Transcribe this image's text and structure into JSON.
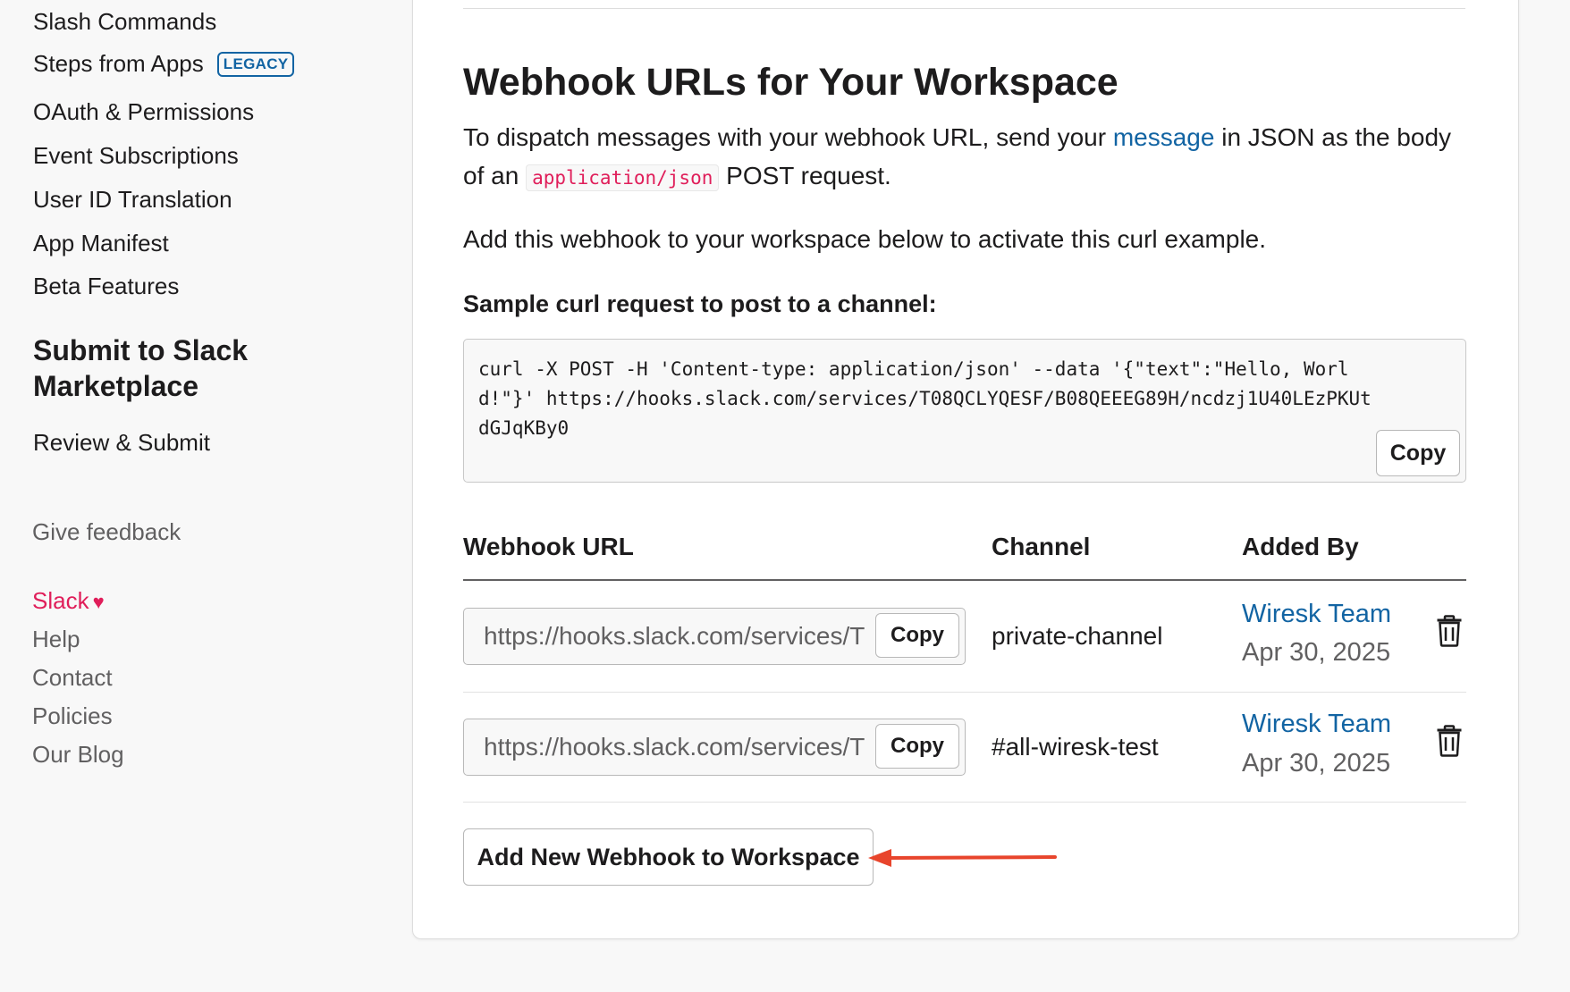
{
  "sidebar": {
    "items": [
      {
        "label": "Slash Commands"
      },
      {
        "label": "Steps from Apps",
        "badge": "LEGACY"
      },
      {
        "label": "OAuth & Permissions"
      },
      {
        "label": "Event Subscriptions"
      },
      {
        "label": "User ID Translation"
      },
      {
        "label": "App Manifest"
      },
      {
        "label": "Beta Features"
      }
    ],
    "section_heading": "Submit to Slack Marketplace",
    "section_items": [
      {
        "label": "Review & Submit"
      }
    ],
    "give_feedback": "Give feedback",
    "footer": {
      "slack": "Slack",
      "heart": "♥",
      "links": [
        "Help",
        "Contact",
        "Policies",
        "Our Blog"
      ]
    }
  },
  "main": {
    "title": "Webhook URLs for Your Workspace",
    "intro": {
      "part1": "To dispatch messages with your webhook URL, send your ",
      "link": "message",
      "part2": " in JSON as the body of an ",
      "code": "application/json",
      "part3": " POST request."
    },
    "activate_text": "Add this webhook to your workspace below to activate this curl example.",
    "curl_label": "Sample curl request to post to a channel:",
    "curl_code": "curl -X POST -H 'Content-type: application/json' --data '{\"text\":\"Hello, World!\"}' https://hooks.slack.com/services/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",
    "copy_label": "Copy",
    "table": {
      "headers": {
        "url": "Webhook URL",
        "channel": "Channel",
        "added_by": "Added By"
      },
      "rows": [
        {
          "url": "https://hooks.slack.com/services/T",
          "copy": "Copy",
          "channel": "private-channel",
          "added_by": "Wiresk Team",
          "date": "Apr 30, 2025",
          "delete_icon": "trash-icon"
        },
        {
          "url": "https://hooks.slack.com/services/T",
          "copy": "Copy",
          "channel": "#all-wiresk-test",
          "added_by": "Wiresk Team",
          "date": "Apr 30, 2025",
          "delete_icon": "trash-icon"
        }
      ]
    },
    "add_button": "Add New Webhook to Workspace",
    "annotation_arrow_color": "#e8452c"
  },
  "colors": {
    "link": "#1264a3",
    "accent_pink": "#e01e5a",
    "text": "#1d1c1d",
    "muted": "#616061"
  }
}
